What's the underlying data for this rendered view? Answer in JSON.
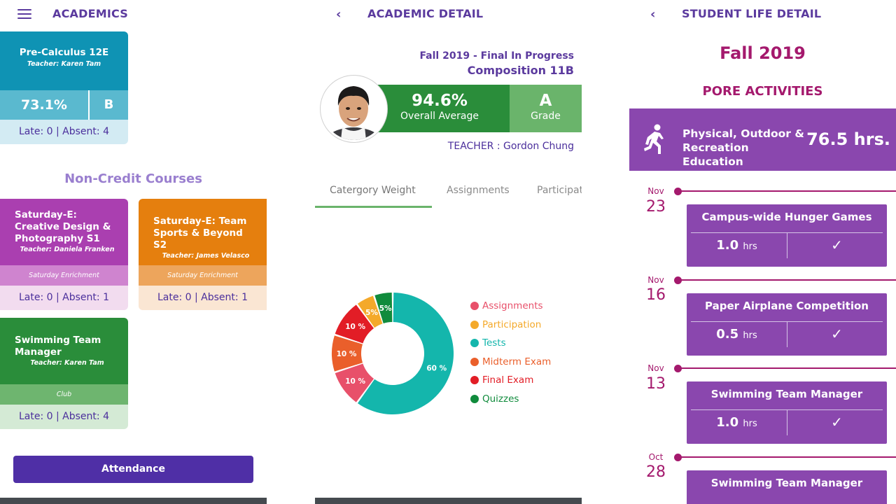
{
  "academics": {
    "title": "ACADEMICS",
    "course": {
      "name": "Pre-Calculus 12E",
      "teacher": "Teacher: Karen Tam",
      "percent": "73.1%",
      "grade": "B",
      "attendance": "Late: 0 | Absent: 4"
    },
    "noncredit_title": "Non-Credit Courses",
    "noncredit": [
      {
        "name": "Saturday-E: Creative Design & Photography S1",
        "teacher": "Teacher: Daniela Franken",
        "category": "Saturday Enrichment",
        "attendance": "Late: 0 | Absent: 1"
      },
      {
        "name": "Saturday-E: Team Sports & Beyond S2",
        "teacher": "Teacher: James Velasco",
        "category": "Saturday Enrichment",
        "attendance": "Late: 0 | Absent: 1"
      },
      {
        "name": "Swimming Team Manager",
        "teacher": "Teacher: Karen Tam",
        "category": "Club",
        "attendance": "Late: 0 | Absent: 4"
      }
    ],
    "attendance_button": "Attendance"
  },
  "detail": {
    "title": "ACADEMIC DETAIL",
    "term": "Fall 2019 - Final In Progress",
    "course": "Composition 11B",
    "average": "94.6%",
    "average_label": "Overall Average",
    "grade": "A",
    "grade_label": "Grade",
    "teacher": "TEACHER : Gordon Chung",
    "tabs": [
      "Catergory Weight",
      "Assignments",
      "Participat"
    ],
    "active_tab": 0
  },
  "chart_data": {
    "type": "pie",
    "title": "",
    "categories": [
      "Assignments",
      "Participation",
      "Tests",
      "Midterm Exam",
      "Final Exam",
      "Quizzes"
    ],
    "values": [
      10,
      5,
      60,
      10,
      10,
      5
    ],
    "labels": [
      "10 %",
      "5%",
      "60 %",
      "10 %",
      "10 %",
      "5%"
    ],
    "colors": [
      "#e8506a",
      "#f4a92a",
      "#14b6ac",
      "#ea5f2b",
      "#e21d26",
      "#108b3c"
    ],
    "legend": "right"
  },
  "student_life": {
    "title": "STUDENT LIFE DETAIL",
    "term": "Fall 2019",
    "category_title": "PORE ACTIVITIES",
    "category": "Physical, Outdoor & Recreation Education",
    "total": "76.5 hrs.",
    "hrs_unit": "hrs",
    "check": "✓",
    "timeline": [
      {
        "month": "Nov",
        "day": "23",
        "activity": "Campus-wide Hunger Games",
        "hours": "1.0"
      },
      {
        "month": "Nov",
        "day": "16",
        "activity": "Paper Airplane Competition",
        "hours": "0.5"
      },
      {
        "month": "Nov",
        "day": "13",
        "activity": "Swimming Team Manager",
        "hours": "1.0"
      },
      {
        "month": "Oct",
        "day": "28",
        "activity": "Swimming Team Manager",
        "hours": ""
      }
    ]
  },
  "colors": {
    "purple": "#5b3a9e",
    "magenta": "#a4196d",
    "green": "#2a8d3a",
    "blue": "#0f93b4",
    "orange": "#e57f0e"
  }
}
